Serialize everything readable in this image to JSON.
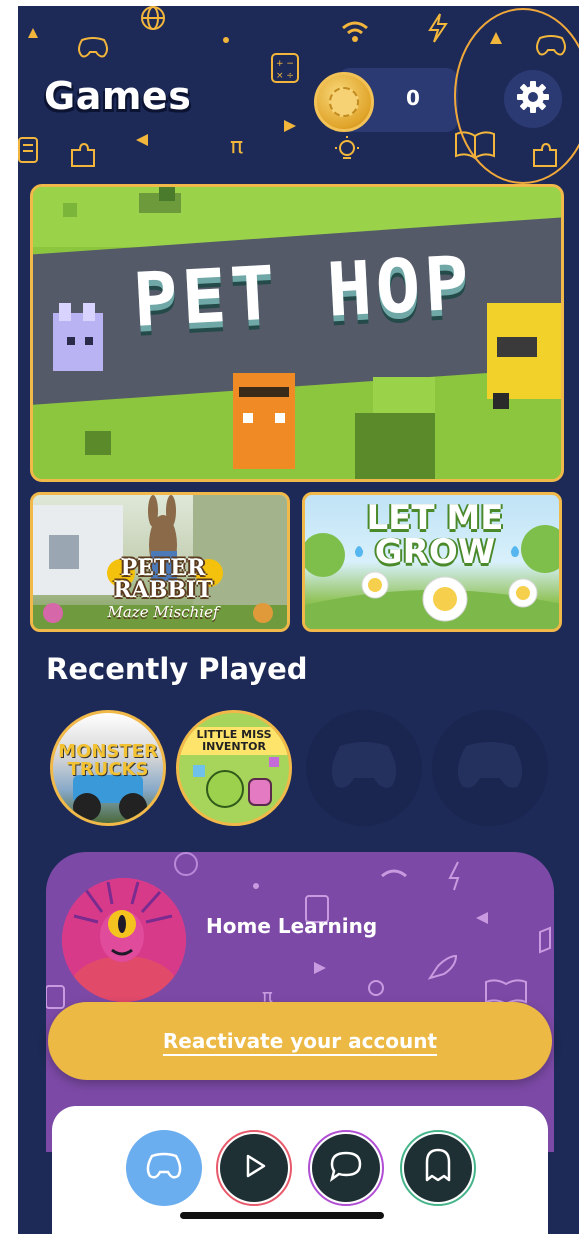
{
  "header": {
    "title": "Games",
    "coin_count": "0",
    "coin_icon": "coin-icon",
    "settings_icon": "gear-icon"
  },
  "featured": {
    "title": "PET HOP"
  },
  "tiles": [
    {
      "title": "PETER RABBIT",
      "subtitle": "Maze Mischief"
    },
    {
      "title": "LET ME GROW"
    }
  ],
  "recently_played": {
    "title": "Recently Played",
    "items": [
      {
        "label": "MONSTER TRUCKS"
      },
      {
        "label": "LITTLE MISS INVENTOR"
      },
      {
        "label": ""
      },
      {
        "label": ""
      }
    ]
  },
  "promo": {
    "label": "Home Learning",
    "cta": "Reactivate your account"
  },
  "tabbar": {
    "items": [
      {
        "icon": "gamepad-icon",
        "color": "#6aaef0"
      },
      {
        "icon": "play-icon",
        "color": "#e85a6b"
      },
      {
        "icon": "chat-icon",
        "color": "#b04fd4"
      },
      {
        "icon": "ghost-icon",
        "color": "#46b48a"
      }
    ]
  },
  "colors": {
    "background": "#1d2a57",
    "accent": "#f0b94a",
    "promo": "#7c4aa6",
    "cta": "#ecb945"
  }
}
